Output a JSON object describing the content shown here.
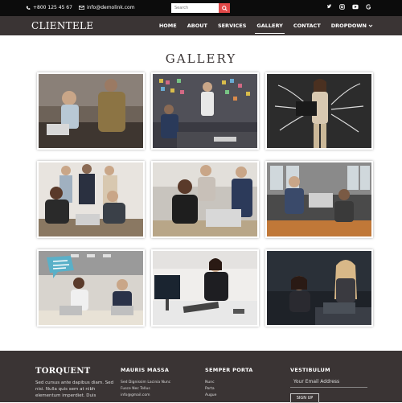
{
  "topbar": {
    "phone": "+800 125 45 67",
    "email": "info@demolink.com",
    "search_placeholder": "Search",
    "social": [
      "twitter-icon",
      "instagram-icon",
      "youtube-icon",
      "google-icon"
    ]
  },
  "brand": "CLIENTELE",
  "nav": {
    "home": "HOME",
    "about": "ABOUT",
    "services": "SERVICES",
    "gallery": "GALLERY",
    "contact": "CONTACT",
    "dropdown": "DROPDOWN"
  },
  "gallery": {
    "title": "GALLERY",
    "images": [
      "two people looking at a laptop",
      "presentation in front of a sticky-note board",
      "businesswoman holding a laptop with chalk arrows",
      "team meeting around laptops",
      "women working together at a laptop",
      "man and woman with laptops by the window",
      "meeting with a speech bubble",
      "woman working at a computer",
      "two women in a dark office"
    ]
  },
  "footer": {
    "col1": {
      "title": "TORQUENT",
      "text": "Sed cursus ante dapibus diam. Sed nisi. Nulla quis sem at nibh elementum imperdiet. Duis"
    },
    "col2": {
      "title": "MAURIS MASSA",
      "links": [
        "Sed Dignissim Lacinia Nunc",
        "Fusce Nec Tellus",
        "info@gmail.com"
      ]
    },
    "col3": {
      "title": "SEMPER PORTA",
      "links": [
        "Nunc",
        "Porta",
        "Augue"
      ]
    },
    "col4": {
      "title": "VESTIBULUM",
      "email_placeholder": "Your Email Address",
      "signup": "SIGN UP"
    }
  },
  "colors": {
    "topbar": "#0c0c0c",
    "navbar": "#3a3434",
    "search_button": "#e04848",
    "footer": "#3a3434"
  }
}
